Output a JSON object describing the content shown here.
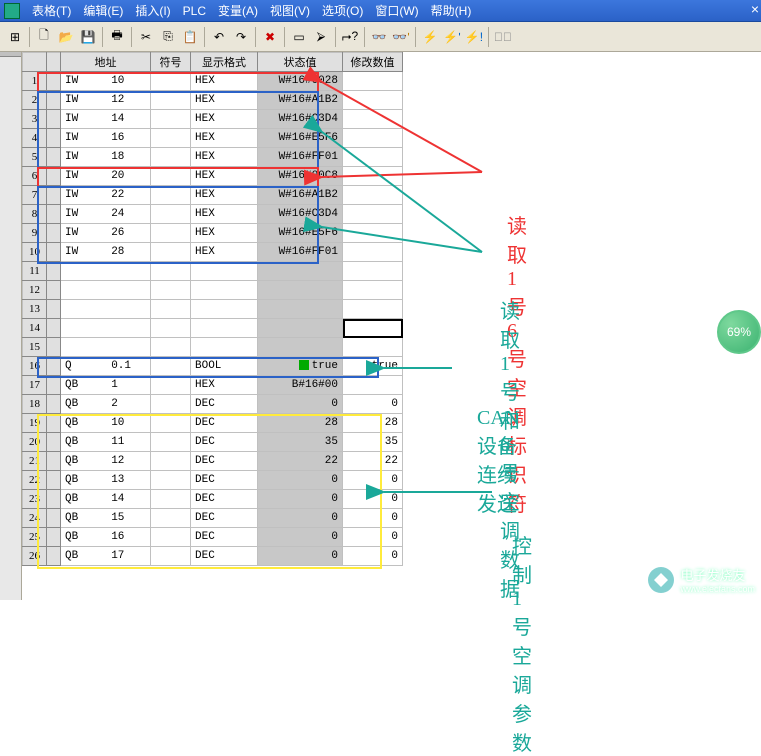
{
  "menu": {
    "items": [
      "表格(T)",
      "编辑(E)",
      "插入(I)",
      "PLC",
      "变量(A)",
      "视图(V)",
      "选项(O)",
      "窗口(W)",
      "帮助(H)"
    ]
  },
  "badge": {
    "pct": "69%"
  },
  "watermark": {
    "text": "电子发烧友",
    "url": "www.elecfans.com"
  },
  "headers": {
    "addr": "地址",
    "sym": "符号",
    "fmt": "显示格式",
    "stat": "状态值",
    "mod": "修改数值"
  },
  "rows": [
    {
      "n": "1",
      "a": "IW     10",
      "f": "HEX",
      "s": "W#16#0028",
      "m": ""
    },
    {
      "n": "2",
      "a": "IW     12",
      "f": "HEX",
      "s": "W#16#A1B2",
      "m": ""
    },
    {
      "n": "3",
      "a": "IW     14",
      "f": "HEX",
      "s": "W#16#C3D4",
      "m": ""
    },
    {
      "n": "4",
      "a": "IW     16",
      "f": "HEX",
      "s": "W#16#E5F6",
      "m": ""
    },
    {
      "n": "5",
      "a": "IW     18",
      "f": "HEX",
      "s": "W#16#FF01",
      "m": ""
    },
    {
      "n": "6",
      "a": "IW     20",
      "f": "HEX",
      "s": "W#16#00C8",
      "m": ""
    },
    {
      "n": "7",
      "a": "IW     22",
      "f": "HEX",
      "s": "W#16#A1B2",
      "m": ""
    },
    {
      "n": "8",
      "a": "IW     24",
      "f": "HEX",
      "s": "W#16#C3D4",
      "m": ""
    },
    {
      "n": "9",
      "a": "IW     26",
      "f": "HEX",
      "s": "W#16#E5F6",
      "m": ""
    },
    {
      "n": "10",
      "a": "IW     28",
      "f": "HEX",
      "s": "W#16#FF01",
      "m": ""
    },
    {
      "n": "11",
      "a": "",
      "f": "",
      "s": "",
      "m": ""
    },
    {
      "n": "12",
      "a": "",
      "f": "",
      "s": "",
      "m": ""
    },
    {
      "n": "13",
      "a": "",
      "f": "",
      "s": "",
      "m": ""
    },
    {
      "n": "14",
      "a": "",
      "f": "",
      "s": "",
      "m": ""
    },
    {
      "n": "15",
      "a": "",
      "f": "",
      "s": "",
      "m": ""
    },
    {
      "n": "16",
      "a": "Q      0.1",
      "f": "BOOL",
      "s": "true",
      "m": "true",
      "green": true
    },
    {
      "n": "17",
      "a": "QB     1",
      "f": "HEX",
      "s": "B#16#00",
      "m": ""
    },
    {
      "n": "18",
      "a": "QB     2",
      "f": "DEC",
      "s": "0",
      "m": "0"
    },
    {
      "n": "19",
      "a": "QB     10",
      "f": "DEC",
      "s": "28",
      "m": "28"
    },
    {
      "n": "20",
      "a": "QB     11",
      "f": "DEC",
      "s": "35",
      "m": "35"
    },
    {
      "n": "21",
      "a": "QB     12",
      "f": "DEC",
      "s": "22",
      "m": "22"
    },
    {
      "n": "22",
      "a": "QB     13",
      "f": "DEC",
      "s": "0",
      "m": "0"
    },
    {
      "n": "23",
      "a": "QB     14",
      "f": "DEC",
      "s": "0",
      "m": "0"
    },
    {
      "n": "24",
      "a": "QB     15",
      "f": "DEC",
      "s": "0",
      "m": "0"
    },
    {
      "n": "25",
      "a": "QB     16",
      "f": "DEC",
      "s": "0",
      "m": "0"
    },
    {
      "n": "26",
      "a": "QB     17",
      "f": "DEC",
      "s": "0",
      "m": "0"
    }
  ],
  "annotations": {
    "a1": "读取1号 6号空调标识符",
    "a2": "读取1号和6号空调数据",
    "a3": "CAN设备连续发送",
    "a4": "控制1号空调参数"
  },
  "toolbar_icons": [
    "window-icon",
    "new-icon",
    "open-icon",
    "save-icon",
    "print-icon",
    "cut-icon",
    "copy-icon",
    "paste-icon",
    "undo-icon",
    "redo-icon",
    "delete-icon",
    "insert-row-icon",
    "goto-icon",
    "pointer-icon",
    "monitor-icon",
    "monitor-once-icon",
    "force-icon",
    "modify-icon",
    "modify-once-icon",
    "activate-icon",
    "help-icon"
  ]
}
